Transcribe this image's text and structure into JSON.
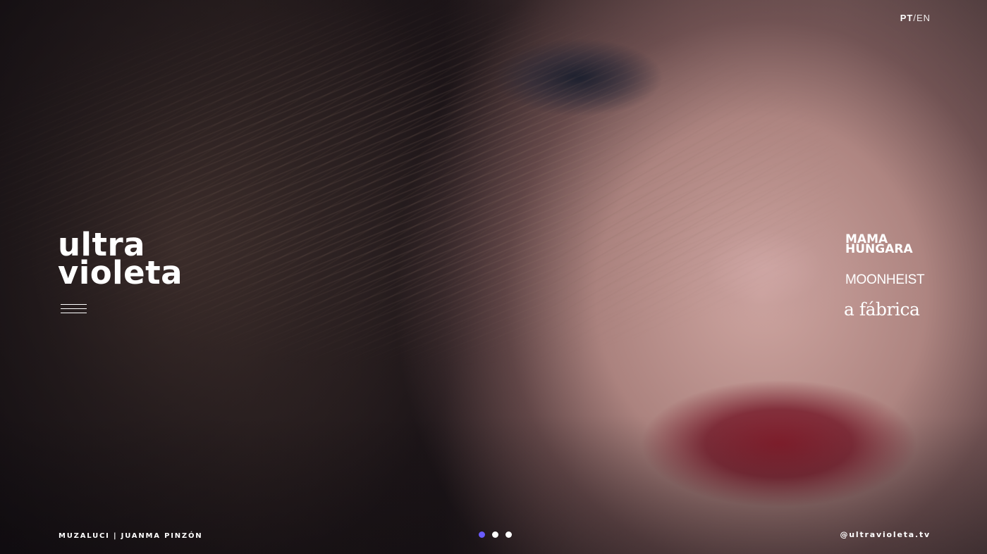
{
  "language": {
    "current": "PT",
    "separator": "/",
    "other": "EN"
  },
  "logo": {
    "line1": "ultra",
    "line2": "violeta"
  },
  "brands": [
    {
      "line1": "MAMA",
      "line2": "HUNGARA"
    },
    {
      "label": "MOONHEIST"
    },
    {
      "label": "a fábrica"
    }
  ],
  "credit": "MUZALUCI | JUANMA PINZÓN",
  "social": "@ultravioleta.tv",
  "slider": {
    "count": 3,
    "active_index": 0,
    "active_color": "#6a5cff",
    "inactive_color": "#ffffff"
  }
}
